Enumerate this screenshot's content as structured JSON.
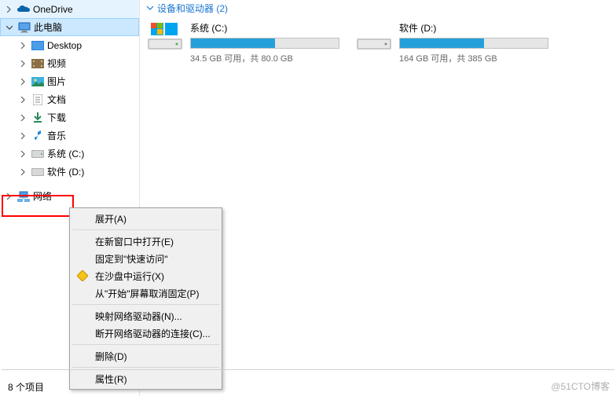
{
  "sidebar": {
    "onedrive": "OneDrive",
    "thispc": "此电脑",
    "items": [
      "Desktop",
      "视频",
      "图片",
      "文档",
      "下载",
      "音乐",
      "系统 (C:)",
      "软件 (D:)"
    ],
    "network": "网络"
  },
  "section": {
    "title": "设备和驱动器 (2)"
  },
  "drives": [
    {
      "name": "系统 (C:)",
      "status": "34.5 GB 可用，共 80.0 GB",
      "fill": 57
    },
    {
      "name": "软件 (D:)",
      "status": "164 GB 可用，共 385 GB",
      "fill": 57
    }
  ],
  "menu": {
    "expand": "展开(A)",
    "newwin": "在新窗口中打开(E)",
    "pinquick": "固定到\"快速访问\"",
    "sandbox": "在沙盘中运行(X)",
    "unpinstart": "从\"开始\"屏幕取消固定(P)",
    "mapnet": "映射网络驱动器(N)...",
    "disconnect": "断开网络驱动器的连接(C)...",
    "delete": "删除(D)",
    "properties": "属性(R)"
  },
  "statusbar": "8 个项目",
  "watermark": "@51CTO博客"
}
